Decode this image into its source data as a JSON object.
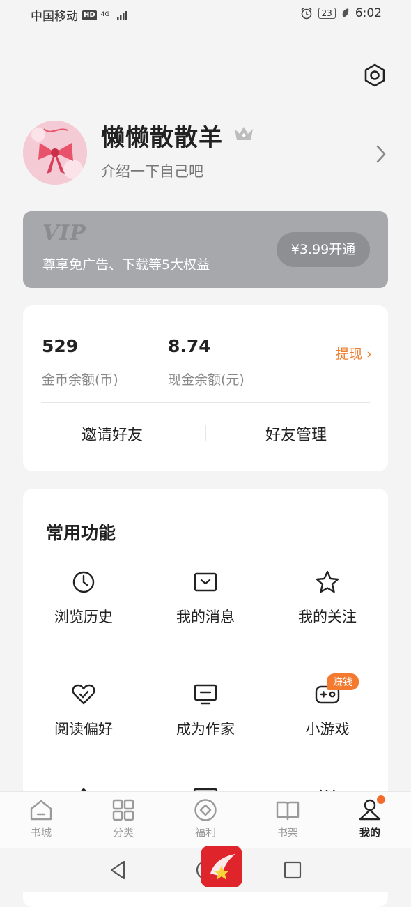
{
  "status_bar": {
    "carrier": "中国移动",
    "hd": "HD",
    "network": "4G⁺",
    "battery": "23",
    "time": "6:02"
  },
  "profile": {
    "username": "懒懒散散羊",
    "bio": "介绍一下自己吧",
    "avatar": "bow-avatar"
  },
  "vip": {
    "logo": "VIP",
    "description": "尊享免广告、下载等5大权益",
    "button": "¥3.99开通"
  },
  "wallet": {
    "coins": {
      "value": "529",
      "label": "金币余额(币)"
    },
    "cash": {
      "value": "8.74",
      "label": "现金余额(元)"
    },
    "withdraw": "提现 ›",
    "actions": [
      "邀请好友",
      "好友管理"
    ]
  },
  "functions": {
    "title": "常用功能",
    "items": [
      {
        "label": "浏览历史",
        "icon": "clock-icon"
      },
      {
        "label": "我的消息",
        "icon": "message-icon"
      },
      {
        "label": "我的关注",
        "icon": "star-icon"
      },
      {
        "label": "阅读偏好",
        "icon": "heart-check-icon"
      },
      {
        "label": "成为作家",
        "icon": "writer-screen-icon"
      },
      {
        "label": "小游戏",
        "icon": "gamepad-icon",
        "badge": "赚钱"
      }
    ]
  },
  "tabbar": {
    "tabs": [
      {
        "label": "书城",
        "icon": "home-icon"
      },
      {
        "label": "分类",
        "icon": "grid-icon"
      },
      {
        "label": "福利",
        "icon": "coin-icon"
      },
      {
        "label": "书架",
        "icon": "book-icon"
      },
      {
        "label": "我的",
        "icon": "person-icon",
        "active": true
      }
    ]
  },
  "colors": {
    "accent": "#f37a2e",
    "vip_bg": "#a6a8ac",
    "background": "#f4f4f4"
  }
}
